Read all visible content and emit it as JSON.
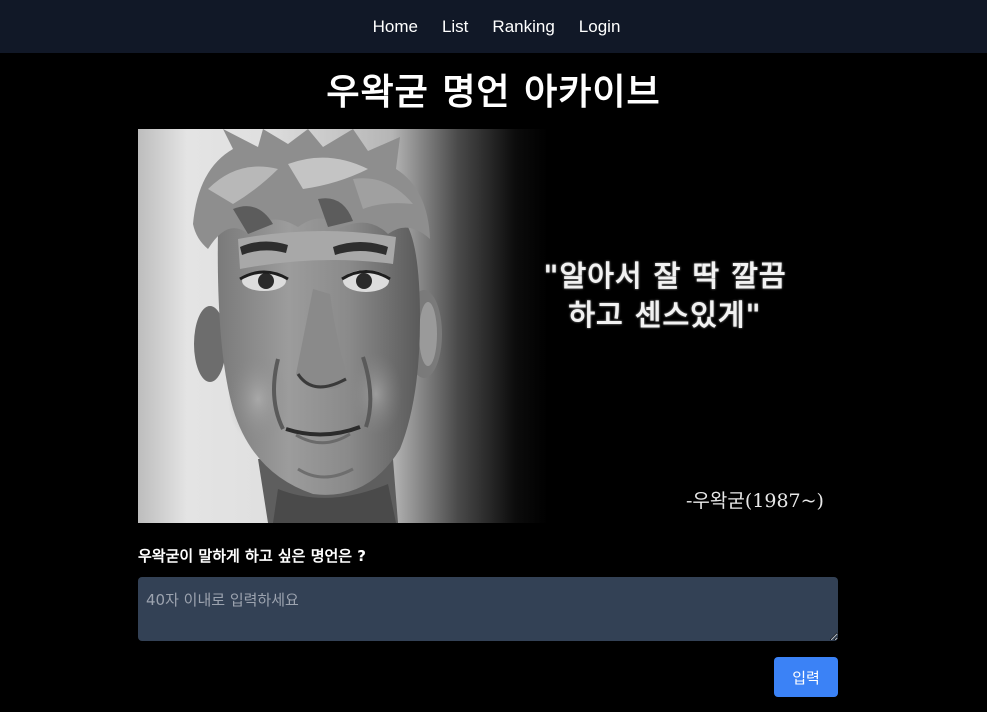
{
  "nav": {
    "items": [
      {
        "label": "Home"
      },
      {
        "label": "List"
      },
      {
        "label": "Ranking"
      },
      {
        "label": "Login"
      }
    ]
  },
  "header": {
    "title": "우왁굳 명언 아카이브"
  },
  "hero": {
    "quote_line1": "\"알아서 잘 딱 깔끔",
    "quote_line2": "하고 센스있게\"",
    "author": "-우왁굳(1987~)"
  },
  "form": {
    "label": "우왁굳이 말하게 하고 싶은 명언은 ?",
    "placeholder": "40자 이내로 입력하세요",
    "value": "",
    "submit_label": "입력"
  },
  "colors": {
    "navbar_bg": "#111827",
    "page_bg": "#000000",
    "input_bg": "#334155",
    "button_bg": "#3b82f6"
  }
}
